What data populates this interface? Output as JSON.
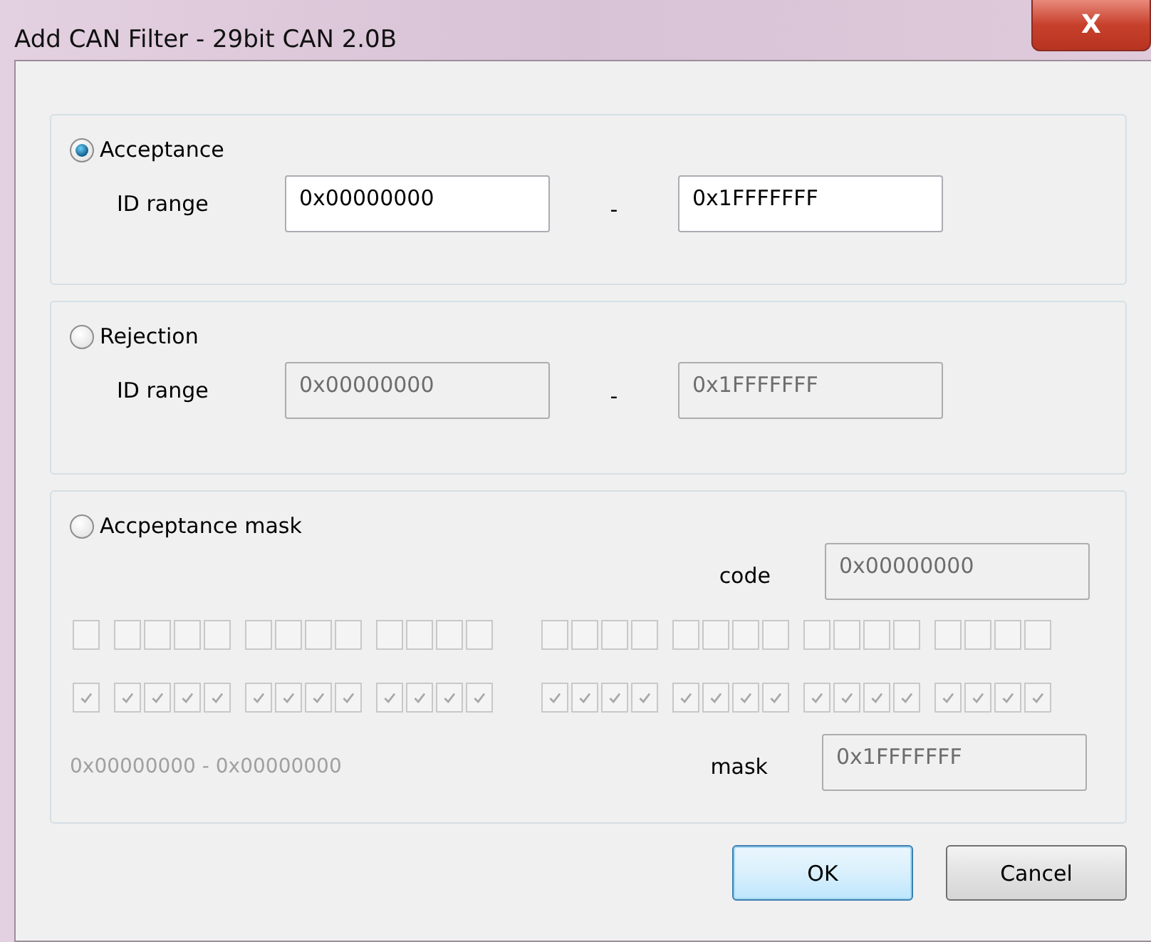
{
  "window": {
    "title": "Add CAN Filter - 29bit CAN 2.0B",
    "close": "X"
  },
  "sections": [
    {
      "kind": "range",
      "label": "Acceptance",
      "selected": true,
      "field_label": "ID range",
      "from": {
        "value": "0x00000000",
        "disabled": false
      },
      "separator": "-",
      "to": {
        "value": "0x1FFFFFFF",
        "disabled": false
      }
    },
    {
      "kind": "range",
      "label": "Rejection",
      "selected": false,
      "field_label": "ID range",
      "from": {
        "value": "0x00000000",
        "disabled": true
      },
      "separator": "-",
      "to": {
        "value": "0x1FFFFFFF",
        "disabled": true
      }
    },
    {
      "kind": "mask",
      "label": "Accpeptance mask",
      "selected": false,
      "code_label": "code",
      "code": {
        "value": "0x00000000",
        "disabled": true
      },
      "code_bits": [
        {
          "checked": false
        },
        {
          "checked": false
        },
        {
          "checked": false
        },
        {
          "checked": false
        },
        {
          "checked": false
        },
        {
          "checked": false
        },
        {
          "checked": false
        },
        {
          "checked": false
        },
        {
          "checked": false
        },
        {
          "checked": false
        },
        {
          "checked": false
        },
        {
          "checked": false
        },
        {
          "checked": false
        },
        {
          "checked": false
        },
        {
          "checked": false
        },
        {
          "checked": false
        },
        {
          "checked": false
        },
        {
          "checked": false
        },
        {
          "checked": false
        },
        {
          "checked": false
        },
        {
          "checked": false
        },
        {
          "checked": false
        },
        {
          "checked": false
        },
        {
          "checked": false
        },
        {
          "checked": false
        },
        {
          "checked": false
        },
        {
          "checked": false
        },
        {
          "checked": false
        },
        {
          "checked": false
        }
      ],
      "mask_bits": [
        {
          "checked": true
        },
        {
          "checked": true
        },
        {
          "checked": true
        },
        {
          "checked": true
        },
        {
          "checked": true
        },
        {
          "checked": true
        },
        {
          "checked": true
        },
        {
          "checked": true
        },
        {
          "checked": true
        },
        {
          "checked": true
        },
        {
          "checked": true
        },
        {
          "checked": true
        },
        {
          "checked": true
        },
        {
          "checked": true
        },
        {
          "checked": true
        },
        {
          "checked": true
        },
        {
          "checked": true
        },
        {
          "checked": true
        },
        {
          "checked": true
        },
        {
          "checked": true
        },
        {
          "checked": true
        },
        {
          "checked": true
        },
        {
          "checked": true
        },
        {
          "checked": true
        },
        {
          "checked": true
        },
        {
          "checked": true
        },
        {
          "checked": true
        },
        {
          "checked": true
        },
        {
          "checked": true
        }
      ],
      "bits_disabled": true,
      "range_text": "0x00000000 - 0x00000000",
      "mask_label": "mask",
      "mask": {
        "value": "0x1FFFFFFF",
        "disabled": true
      }
    }
  ],
  "buttons": [
    {
      "label": "OK",
      "default": true
    },
    {
      "label": "Cancel",
      "default": false
    }
  ]
}
